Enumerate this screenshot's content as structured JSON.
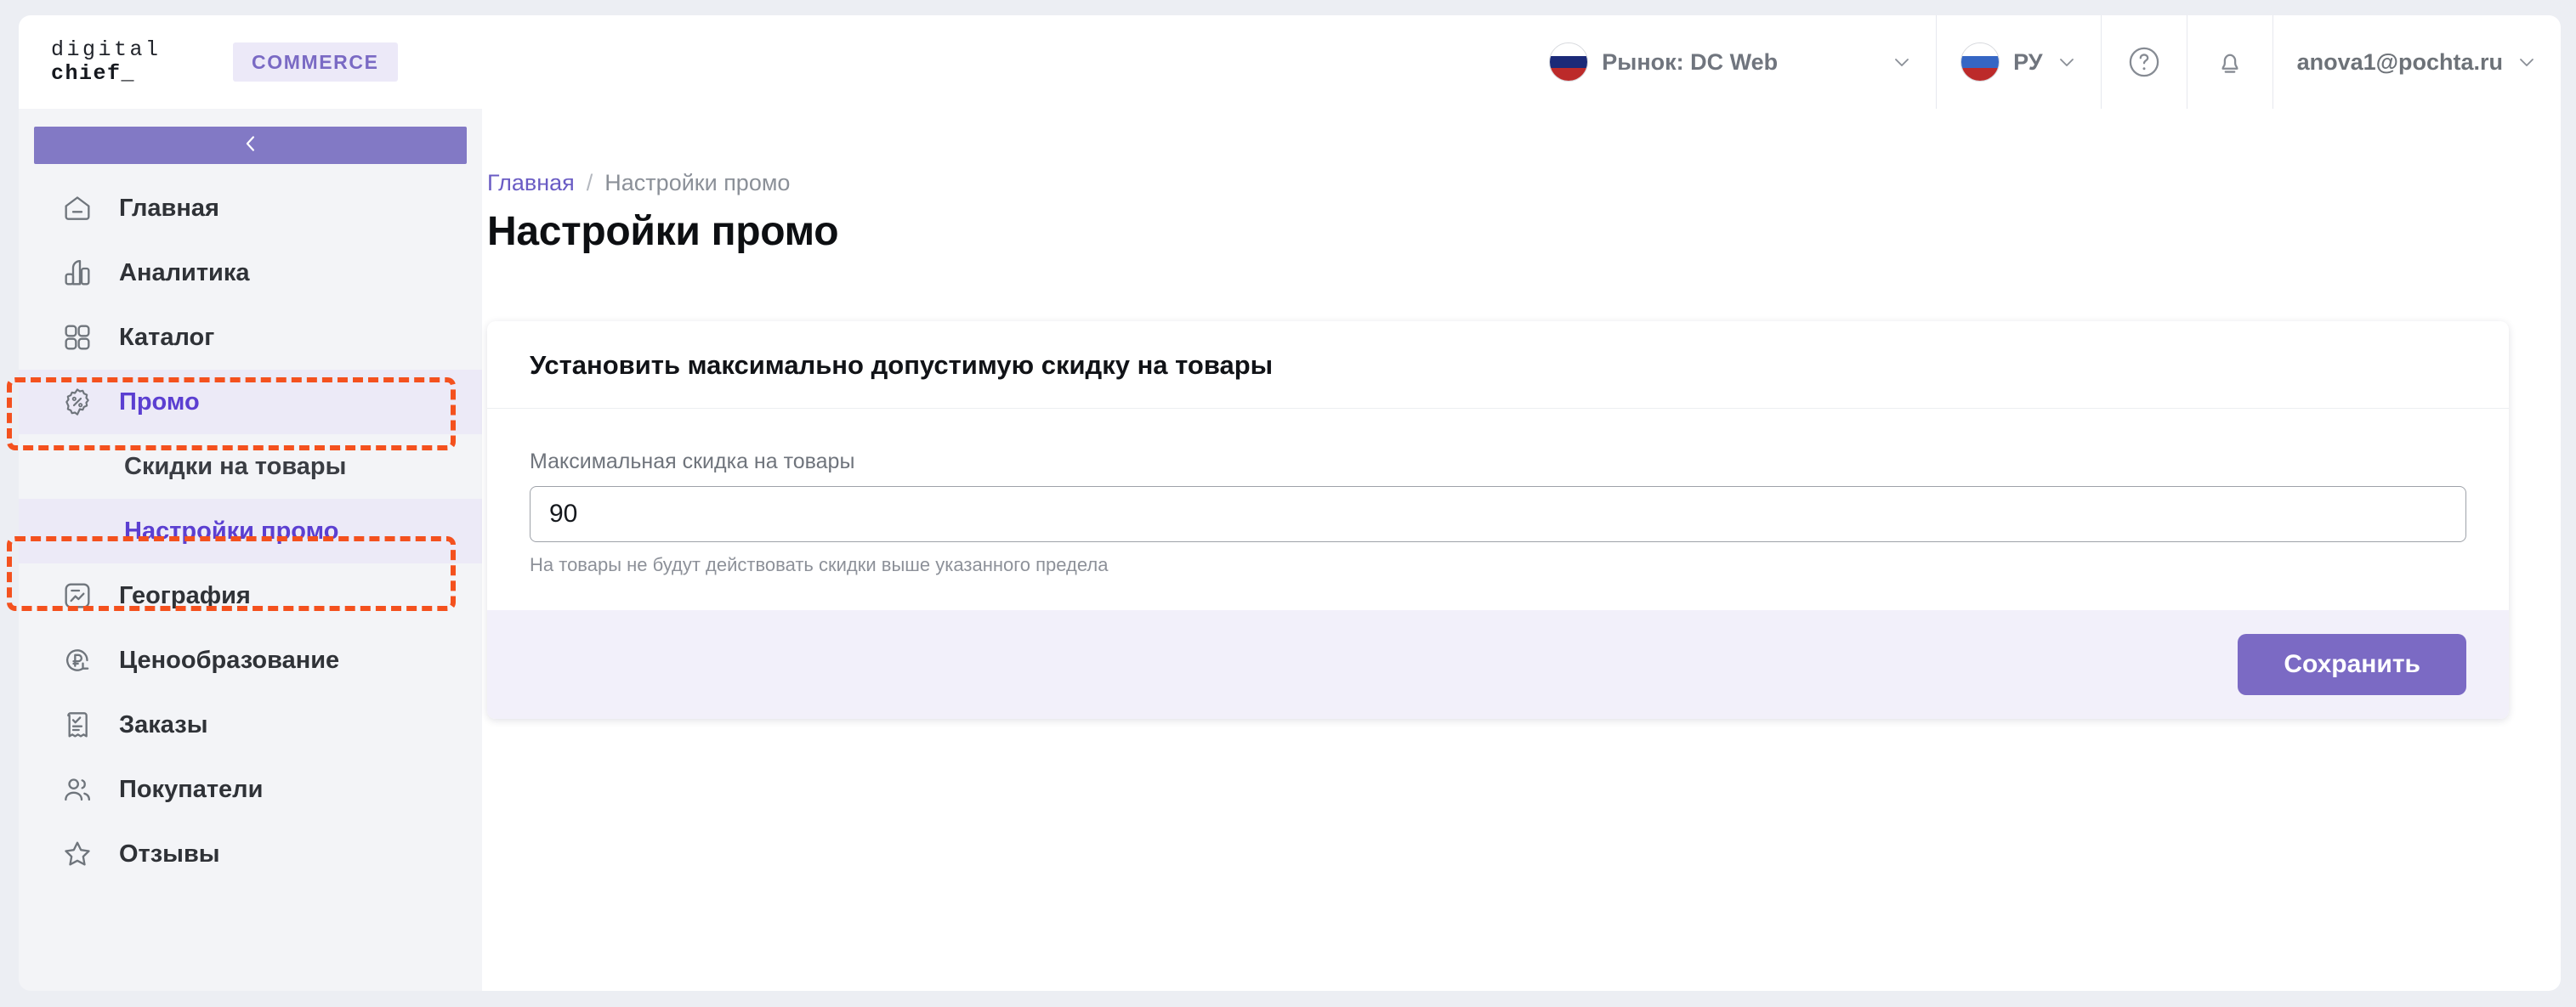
{
  "header": {
    "logo": {
      "line1": "digital",
      "line2": "chief_",
      "badge": "COMMERCE"
    },
    "market": {
      "label": "Рынок: DC Web",
      "flag_icon": "russia-flag-icon",
      "chevron_icon": "chevron-down-icon"
    },
    "language": {
      "label": "РУ",
      "flag_icon": "russia-flag-icon",
      "chevron_icon": "chevron-down-icon"
    },
    "help_icon": "question-circle-icon",
    "notifications_icon": "bell-icon",
    "user": {
      "email": "anova1@pochta.ru",
      "chevron_icon": "chevron-down-icon"
    }
  },
  "sidebar": {
    "collapse_icon": "chevron-left-icon",
    "items": [
      {
        "label": "Главная",
        "icon": "home-icon",
        "type": "item",
        "active": false
      },
      {
        "label": "Аналитика",
        "icon": "bar-chart-icon",
        "type": "item",
        "active": false
      },
      {
        "label": "Каталог",
        "icon": "grid-icon",
        "type": "item",
        "active": false
      },
      {
        "label": "Промо",
        "icon": "percent-badge-icon",
        "type": "item",
        "active": true
      },
      {
        "label": "Скидки на товары",
        "icon": "",
        "type": "sub",
        "active": false
      },
      {
        "label": "Настройки промо",
        "icon": "",
        "type": "sub",
        "active": true
      },
      {
        "label": "География",
        "icon": "map-trend-icon",
        "type": "item",
        "active": false
      },
      {
        "label": "Ценообразование",
        "icon": "ruble-refresh-icon",
        "type": "item",
        "active": false
      },
      {
        "label": "Заказы",
        "icon": "receipt-check-icon",
        "type": "item",
        "active": false
      },
      {
        "label": "Покупатели",
        "icon": "users-icon",
        "type": "item",
        "active": false
      },
      {
        "label": "Отзывы",
        "icon": "star-icon",
        "type": "item",
        "active": false
      }
    ]
  },
  "main": {
    "breadcrumb": {
      "home": "Главная",
      "separator": "/",
      "current": "Настройки промо"
    },
    "page_title": "Настройки промо",
    "card": {
      "heading": "Установить максимально допустимую скидку на товары",
      "field": {
        "label": "Максимальная скидка на товары",
        "value": "90",
        "placeholder": "",
        "help": "На товары не будут действовать скидки выше указанного предела"
      },
      "save_label": "Сохранить"
    }
  },
  "colors": {
    "accent_purple": "#7b6ac4",
    "active_text": "#5b3fd1",
    "annotation_orange": "#f4511e",
    "footer_bg": "#f2f0fa",
    "sidebar_bg": "#f3f4f7"
  }
}
